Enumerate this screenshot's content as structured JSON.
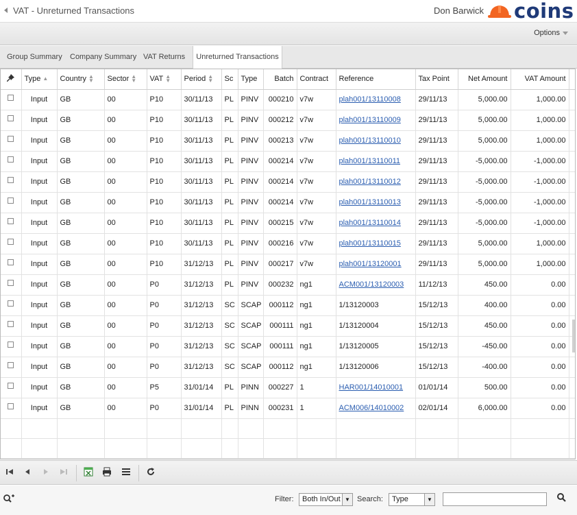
{
  "header": {
    "title": "VAT - Unreturned Transactions",
    "user": "Don Barwick",
    "logo_text": "coins"
  },
  "options": {
    "label": "Options"
  },
  "tabs": [
    {
      "label": "Group Summary"
    },
    {
      "label": "Company Summary"
    },
    {
      "label": "VAT Returns"
    },
    {
      "label": "Unreturned Transactions"
    }
  ],
  "grid": {
    "columns": [
      "Type",
      "Country",
      "Sector",
      "VAT",
      "Period",
      "Sc",
      "Type",
      "Batch",
      "Contract",
      "Reference",
      "Tax Point",
      "Net Amount",
      "VAT Amount"
    ],
    "rows": [
      {
        "type": "Input",
        "country": "GB",
        "sector": "00",
        "vat": "P10",
        "period": "30/11/13",
        "sc": "PL",
        "ttype": "PINV",
        "batch": "000210",
        "contract": "v7w",
        "reference": "plah001/13110008",
        "ref_link": true,
        "tax_point": "29/11/13",
        "net": "5,000.00",
        "vat_amount": "1,000.00"
      },
      {
        "type": "Input",
        "country": "GB",
        "sector": "00",
        "vat": "P10",
        "period": "30/11/13",
        "sc": "PL",
        "ttype": "PINV",
        "batch": "000212",
        "contract": "v7w",
        "reference": "plah001/13110009",
        "ref_link": true,
        "tax_point": "29/11/13",
        "net": "5,000.00",
        "vat_amount": "1,000.00"
      },
      {
        "type": "Input",
        "country": "GB",
        "sector": "00",
        "vat": "P10",
        "period": "30/11/13",
        "sc": "PL",
        "ttype": "PINV",
        "batch": "000213",
        "contract": "v7w",
        "reference": "plah001/13110010",
        "ref_link": true,
        "tax_point": "29/11/13",
        "net": "5,000.00",
        "vat_amount": "1,000.00"
      },
      {
        "type": "Input",
        "country": "GB",
        "sector": "00",
        "vat": "P10",
        "period": "30/11/13",
        "sc": "PL",
        "ttype": "PINV",
        "batch": "000214",
        "contract": "v7w",
        "reference": "plah001/13110011",
        "ref_link": true,
        "tax_point": "29/11/13",
        "net": "-5,000.00",
        "vat_amount": "-1,000.00"
      },
      {
        "type": "Input",
        "country": "GB",
        "sector": "00",
        "vat": "P10",
        "period": "30/11/13",
        "sc": "PL",
        "ttype": "PINV",
        "batch": "000214",
        "contract": "v7w",
        "reference": "plah001/13110012",
        "ref_link": true,
        "tax_point": "29/11/13",
        "net": "-5,000.00",
        "vat_amount": "-1,000.00"
      },
      {
        "type": "Input",
        "country": "GB",
        "sector": "00",
        "vat": "P10",
        "period": "30/11/13",
        "sc": "PL",
        "ttype": "PINV",
        "batch": "000214",
        "contract": "v7w",
        "reference": "plah001/13110013",
        "ref_link": true,
        "tax_point": "29/11/13",
        "net": "-5,000.00",
        "vat_amount": "-1,000.00"
      },
      {
        "type": "Input",
        "country": "GB",
        "sector": "00",
        "vat": "P10",
        "period": "30/11/13",
        "sc": "PL",
        "ttype": "PINV",
        "batch": "000215",
        "contract": "v7w",
        "reference": "plah001/13110014",
        "ref_link": true,
        "tax_point": "29/11/13",
        "net": "-5,000.00",
        "vat_amount": "-1,000.00"
      },
      {
        "type": "Input",
        "country": "GB",
        "sector": "00",
        "vat": "P10",
        "period": "30/11/13",
        "sc": "PL",
        "ttype": "PINV",
        "batch": "000216",
        "contract": "v7w",
        "reference": "plah001/13110015",
        "ref_link": true,
        "tax_point": "29/11/13",
        "net": "5,000.00",
        "vat_amount": "1,000.00"
      },
      {
        "type": "Input",
        "country": "GB",
        "sector": "00",
        "vat": "P10",
        "period": "31/12/13",
        "sc": "PL",
        "ttype": "PINV",
        "batch": "000217",
        "contract": "v7w",
        "reference": "plah001/13120001",
        "ref_link": true,
        "tax_point": "29/11/13",
        "net": "5,000.00",
        "vat_amount": "1,000.00"
      },
      {
        "type": "Input",
        "country": "GB",
        "sector": "00",
        "vat": "P0",
        "period": "31/12/13",
        "sc": "PL",
        "ttype": "PINV",
        "batch": "000232",
        "contract": "ng1",
        "reference": "ACM001/13120003",
        "ref_link": true,
        "tax_point": "11/12/13",
        "net": "450.00",
        "vat_amount": "0.00"
      },
      {
        "type": "Input",
        "country": "GB",
        "sector": "00",
        "vat": "P0",
        "period": "31/12/13",
        "sc": "SC",
        "ttype": "SCAP",
        "batch": "000112",
        "contract": "ng1",
        "reference": "1/13120003",
        "ref_link": false,
        "tax_point": "15/12/13",
        "net": "400.00",
        "vat_amount": "0.00"
      },
      {
        "type": "Input",
        "country": "GB",
        "sector": "00",
        "vat": "P0",
        "period": "31/12/13",
        "sc": "SC",
        "ttype": "SCAP",
        "batch": "000111",
        "contract": "ng1",
        "reference": "1/13120004",
        "ref_link": false,
        "tax_point": "15/12/13",
        "net": "450.00",
        "vat_amount": "0.00"
      },
      {
        "type": "Input",
        "country": "GB",
        "sector": "00",
        "vat": "P0",
        "period": "31/12/13",
        "sc": "SC",
        "ttype": "SCAP",
        "batch": "000111",
        "contract": "ng1",
        "reference": "1/13120005",
        "ref_link": false,
        "tax_point": "15/12/13",
        "net": "-450.00",
        "vat_amount": "0.00"
      },
      {
        "type": "Input",
        "country": "GB",
        "sector": "00",
        "vat": "P0",
        "period": "31/12/13",
        "sc": "SC",
        "ttype": "SCAP",
        "batch": "000112",
        "contract": "ng1",
        "reference": "1/13120006",
        "ref_link": false,
        "tax_point": "15/12/13",
        "net": "-400.00",
        "vat_amount": "0.00"
      },
      {
        "type": "Input",
        "country": "GB",
        "sector": "00",
        "vat": "P5",
        "period": "31/01/14",
        "sc": "PL",
        "ttype": "PINN",
        "batch": "000227",
        "contract": "1",
        "reference": "HAR001/14010001",
        "ref_link": true,
        "tax_point": "01/01/14",
        "net": "500.00",
        "vat_amount": "0.00"
      },
      {
        "type": "Input",
        "country": "GB",
        "sector": "00",
        "vat": "P0",
        "period": "31/01/14",
        "sc": "PL",
        "ttype": "PINN",
        "batch": "000231",
        "contract": "1",
        "reference": "ACM006/14010002",
        "ref_link": true,
        "tax_point": "02/01/14",
        "net": "6,000.00",
        "vat_amount": "0.00"
      }
    ]
  },
  "filter": {
    "filter_label": "Filter:",
    "filter_value": "Both In/Out",
    "search_label": "Search:",
    "search_field": "Type",
    "search_value": ""
  },
  "icons": {
    "back": "back-arrow-icon",
    "first": "first-page-icon",
    "prev": "prev-page-icon",
    "next": "next-page-icon",
    "last": "last-page-icon",
    "excel": "excel-export-icon",
    "print": "print-icon",
    "columns": "columns-icon",
    "refresh": "refresh-icon",
    "add_search": "add-search-icon",
    "search": "search-icon",
    "pin": "pin-icon"
  }
}
